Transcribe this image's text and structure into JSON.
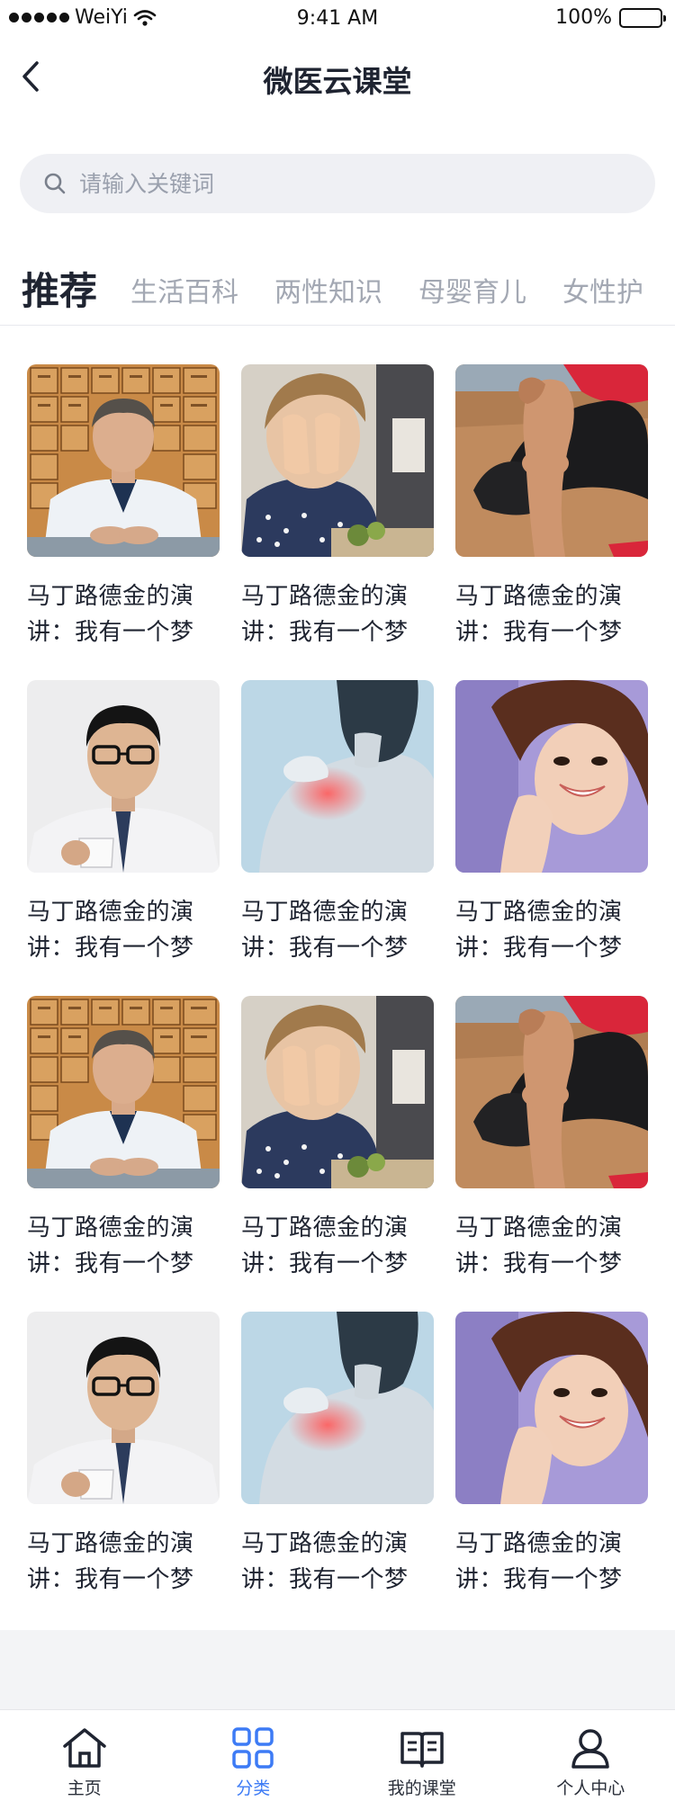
{
  "status": {
    "carrier": "WeiYi",
    "time": "9:41 AM",
    "battery_text": "100%",
    "battery_level": 1.0
  },
  "nav": {
    "title": "微医云课堂"
  },
  "search": {
    "placeholder": "请输入关键词",
    "value": ""
  },
  "tabs": [
    {
      "label": "推荐",
      "active": true
    },
    {
      "label": "生活百科",
      "active": false
    },
    {
      "label": "两性知识",
      "active": false
    },
    {
      "label": "母婴育儿",
      "active": false
    },
    {
      "label": "女性护",
      "active": false
    }
  ],
  "courses": [
    {
      "title": "马丁路德金的演讲：我有一个梦",
      "image": "doctor-portrait"
    },
    {
      "title": "马丁路德金的演讲：我有一个梦",
      "image": "child-covering-eyes"
    },
    {
      "title": "马丁路德金的演讲：我有一个梦",
      "image": "knee-pain"
    },
    {
      "title": "马丁路德金的演讲：我有一个梦",
      "image": "man-with-glasses-mug"
    },
    {
      "title": "马丁路德金的演讲：我有一个梦",
      "image": "shoulder-pain"
    },
    {
      "title": "马丁路德金的演讲：我有一个梦",
      "image": "smiling-woman"
    },
    {
      "title": "马丁路德金的演讲：我有一个梦",
      "image": "doctor-portrait"
    },
    {
      "title": "马丁路德金的演讲：我有一个梦",
      "image": "child-covering-eyes"
    },
    {
      "title": "马丁路德金的演讲：我有一个梦",
      "image": "knee-pain"
    },
    {
      "title": "马丁路德金的演讲：我有一个梦",
      "image": "man-with-glasses-mug"
    },
    {
      "title": "马丁路德金的演讲：我有一个梦",
      "image": "shoulder-pain"
    },
    {
      "title": "马丁路德金的演讲：我有一个梦",
      "image": "smiling-woman"
    }
  ],
  "tabbar": [
    {
      "label": "主页",
      "icon": "home-icon",
      "active": false
    },
    {
      "label": "分类",
      "icon": "grid-icon",
      "active": true
    },
    {
      "label": "我的课堂",
      "icon": "book-icon",
      "active": false
    },
    {
      "label": "个人中心",
      "icon": "user-icon",
      "active": false
    }
  ],
  "colors": {
    "accent": "#3d7bf5",
    "text": "#1f2431",
    "muted": "#a3a8b3",
    "search_bg": "#eff0f4"
  }
}
